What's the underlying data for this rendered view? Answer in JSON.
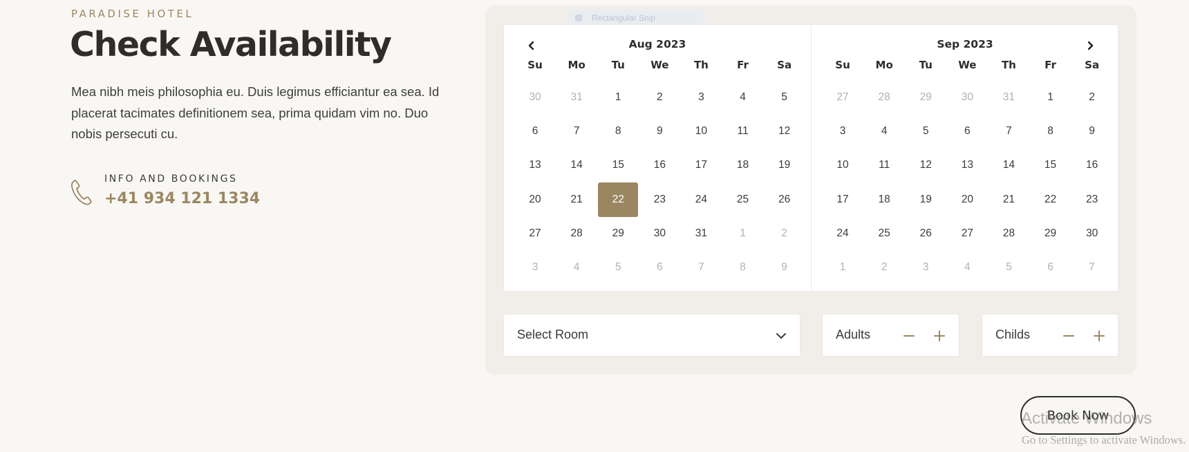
{
  "hero": {
    "eyebrow": "PARADISE HOTEL",
    "title": "Check Availability",
    "description": "Mea nibh meis philosophia eu. Duis legimus efficiantur ea sea. Id placerat tacimates definitionem sea, prima quidam vim no. Duo nobis persecuti cu.",
    "info_label": "INFO AND BOOKINGS",
    "phone": "+41 934 121 1334"
  },
  "ghost_chip": "Rectangular Snip",
  "colors": {
    "accent": "#9a8762",
    "text": "#2f2d2b",
    "muted": "#b4b0ab",
    "panel": "#f1eeea",
    "page": "#f9f7f4"
  },
  "calendar": {
    "weekdays": [
      "Su",
      "Mo",
      "Tu",
      "We",
      "Th",
      "Fr",
      "Sa"
    ],
    "selected": "22",
    "months": [
      {
        "title": "Aug 2023",
        "days": [
          {
            "d": "30",
            "m": true
          },
          {
            "d": "31",
            "m": true
          },
          {
            "d": "1"
          },
          {
            "d": "2"
          },
          {
            "d": "3"
          },
          {
            "d": "4"
          },
          {
            "d": "5"
          },
          {
            "d": "6"
          },
          {
            "d": "7"
          },
          {
            "d": "8"
          },
          {
            "d": "9"
          },
          {
            "d": "10"
          },
          {
            "d": "11"
          },
          {
            "d": "12"
          },
          {
            "d": "13"
          },
          {
            "d": "14"
          },
          {
            "d": "15"
          },
          {
            "d": "16"
          },
          {
            "d": "17"
          },
          {
            "d": "18"
          },
          {
            "d": "19"
          },
          {
            "d": "20"
          },
          {
            "d": "21"
          },
          {
            "d": "22",
            "s": true
          },
          {
            "d": "23"
          },
          {
            "d": "24"
          },
          {
            "d": "25"
          },
          {
            "d": "26"
          },
          {
            "d": "27"
          },
          {
            "d": "28"
          },
          {
            "d": "29"
          },
          {
            "d": "30"
          },
          {
            "d": "31"
          },
          {
            "d": "1",
            "m": true
          },
          {
            "d": "2",
            "m": true
          },
          {
            "d": "3",
            "m": true
          },
          {
            "d": "4",
            "m": true
          },
          {
            "d": "5",
            "m": true
          },
          {
            "d": "6",
            "m": true
          },
          {
            "d": "7",
            "m": true
          },
          {
            "d": "8",
            "m": true
          },
          {
            "d": "9",
            "m": true
          }
        ]
      },
      {
        "title": "Sep 2023",
        "days": [
          {
            "d": "27",
            "m": true
          },
          {
            "d": "28",
            "m": true
          },
          {
            "d": "29",
            "m": true
          },
          {
            "d": "30",
            "m": true
          },
          {
            "d": "31",
            "m": true
          },
          {
            "d": "1"
          },
          {
            "d": "2"
          },
          {
            "d": "3"
          },
          {
            "d": "4"
          },
          {
            "d": "5"
          },
          {
            "d": "6"
          },
          {
            "d": "7"
          },
          {
            "d": "8"
          },
          {
            "d": "9"
          },
          {
            "d": "10"
          },
          {
            "d": "11"
          },
          {
            "d": "12"
          },
          {
            "d": "13"
          },
          {
            "d": "14"
          },
          {
            "d": "15"
          },
          {
            "d": "16"
          },
          {
            "d": "17"
          },
          {
            "d": "18"
          },
          {
            "d": "19"
          },
          {
            "d": "20"
          },
          {
            "d": "21"
          },
          {
            "d": "22"
          },
          {
            "d": "23"
          },
          {
            "d": "24"
          },
          {
            "d": "25"
          },
          {
            "d": "26"
          },
          {
            "d": "27"
          },
          {
            "d": "28"
          },
          {
            "d": "29"
          },
          {
            "d": "30"
          },
          {
            "d": "1",
            "m": true
          },
          {
            "d": "2",
            "m": true
          },
          {
            "d": "3",
            "m": true
          },
          {
            "d": "4",
            "m": true
          },
          {
            "d": "5",
            "m": true
          },
          {
            "d": "6",
            "m": true
          },
          {
            "d": "7",
            "m": true
          }
        ]
      }
    ]
  },
  "form": {
    "select_room": "Select Room",
    "adults": "Adults",
    "childs": "Childs",
    "minus": "−",
    "plus": "+"
  },
  "book_now": "Book Now",
  "watermark": {
    "line1": "Activate Windows",
    "line2": "Go to Settings to activate Windows."
  }
}
